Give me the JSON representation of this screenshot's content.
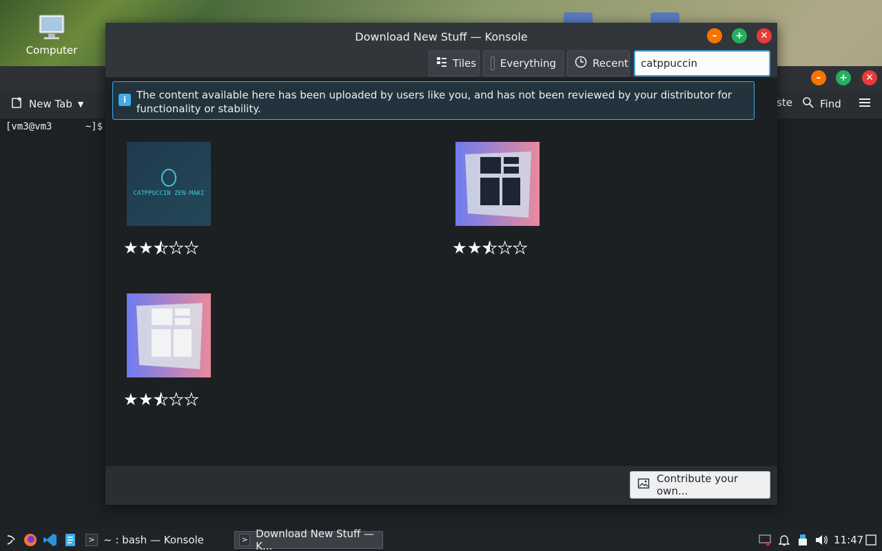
{
  "desktop": {
    "computer_label": "Computer"
  },
  "konsole": {
    "new_tab_label": "New Tab",
    "paste_label": "ste",
    "find_label": "Find",
    "prompt": "[vm3@vm3",
    "prompt_tail": "~]$"
  },
  "dialog": {
    "title": "Download New Stuff — Konsole",
    "toolbar": {
      "tiles": "Tiles",
      "everything": "Everything",
      "recent": "Recent"
    },
    "search": {
      "value": "catppuccin"
    },
    "info_message": "The content available here has been uploaded by users like you, and has not been reviewed by your distributor for functionality or stability.",
    "thumb1_text": "CATPPUCCIN ZEN-MAKI",
    "contribute_label": "Contribute your own..."
  },
  "items": [
    {
      "rating_stars": 2.5
    },
    {
      "rating_stars": 2.5
    },
    {
      "rating_stars": 2.5
    }
  ],
  "taskbar": {
    "task1": "~ : bash — Konsole",
    "task2": "Download New Stuff — K...",
    "clock": "11:47"
  },
  "colors": {
    "accent": "#3daee9",
    "close": "#e93a3a",
    "minimize": "#f67400",
    "maximize": "#27ae60"
  }
}
